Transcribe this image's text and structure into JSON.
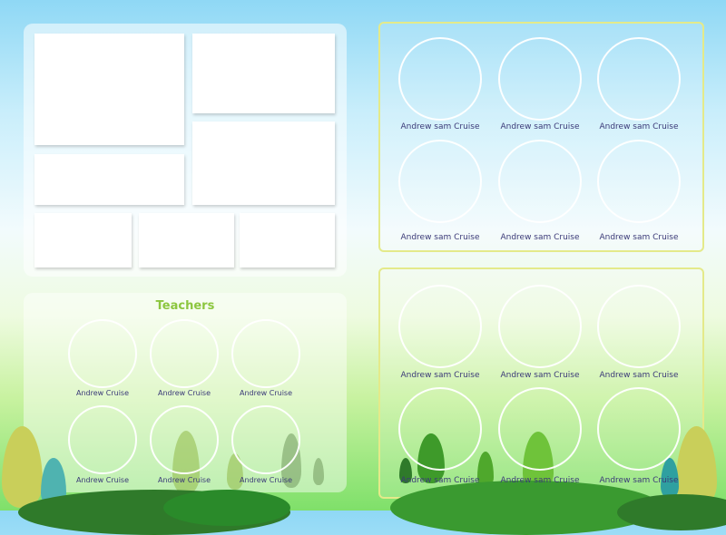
{
  "teachers": {
    "title": "Teachers",
    "names": [
      "Andrew Cruise",
      "Andrew Cruise",
      "Andrew Cruise",
      "Andrew Cruise",
      "Andrew Cruise",
      "Andrew Cruise"
    ]
  },
  "students_top": {
    "names": [
      "Andrew sam Cruise",
      "Andrew sam Cruise",
      "Andrew sam Cruise",
      "Andrew sam Cruise",
      "Andrew sam Cruise",
      "Andrew sam Cruise"
    ]
  },
  "students_bottom": {
    "names": [
      "Andrew sam Cruise",
      "Andrew sam Cruise",
      "Andrew sam Cruise",
      "Andrew sam Cruise",
      "Andrew sam Cruise",
      "Andrew sam Cruise"
    ]
  },
  "colors": {
    "title": "#8cc63f",
    "name": "#3b3a78",
    "frame": "#e4ea8a"
  }
}
